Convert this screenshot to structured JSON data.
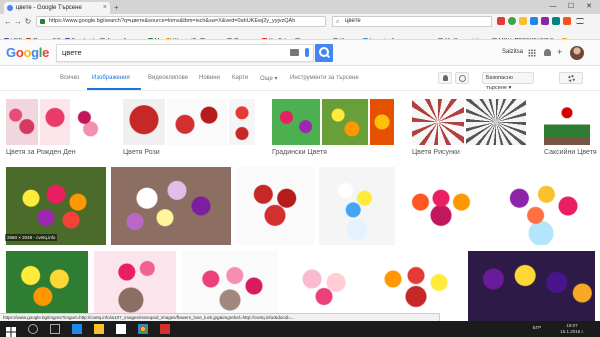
{
  "browser": {
    "tab_title": "цвете - Google Търсене",
    "close_tab_glyph": "×",
    "new_tab_glyph": "+",
    "url": "https://www.google.bg/search?q=цвете&source=lnms&tbm=isch&sa=X&ved=0ahUKEwj2y_yyjvzQAh",
    "find_text": "цвете",
    "controls": {
      "minimize": "—",
      "maximize": "☐",
      "close": "✕"
    }
  },
  "bookmarks": [
    {
      "label": "UBB",
      "color": "#3b5998"
    },
    {
      "label": "Проект ЕС",
      "color": "#c0392b"
    },
    {
      "label": "Facebook",
      "color": "#3b5998"
    },
    {
      "label": "Ангел Ангелов",
      "color": "#888888"
    },
    {
      "label": "My",
      "color": "#2e7d32"
    },
    {
      "label": "Школа IT",
      "color": "#f39c12"
    },
    {
      "label": "уча се",
      "color": "#888888"
    },
    {
      "label": "Падагози",
      "color": "#888888"
    },
    {
      "label": "YouTube",
      "color": "#e62117"
    },
    {
      "label": "за учители",
      "color": "#888888"
    },
    {
      "label": "Изпели",
      "color": "#888888"
    },
    {
      "label": "LearningApps.org - инте...",
      "color": "#2196f3"
    },
    {
      "label": "My Presentations",
      "color": "#888888"
    },
    {
      "label": "МОН: ПРОЕКТ ИКТ В...",
      "color": "#888888"
    },
    {
      "label": "уроци",
      "color": "#f39c12"
    }
  ],
  "google": {
    "logo": [
      "G",
      "o",
      "o",
      "g",
      "l",
      "e"
    ],
    "logo_colors": [
      "#4285f4",
      "#ea4335",
      "#fbbc05",
      "#4285f4",
      "#34a853",
      "#ea4335"
    ],
    "query": "цвете",
    "user_name": "Salzitsa"
  },
  "search_tabs": [
    {
      "label": "Всичко",
      "active": false
    },
    {
      "label": "Изображения",
      "active": true
    },
    {
      "label": "Видеоклипове",
      "active": false
    },
    {
      "label": "Новини",
      "active": false
    },
    {
      "label": "Карти",
      "active": false
    },
    {
      "label": "Още ▾",
      "active": false
    },
    {
      "label": "Инструменти за търсене",
      "active": false
    }
  ],
  "safe_search_label": "Безопасно търсене ▾",
  "related": [
    {
      "label": "Цветя за Рожден Ден"
    },
    {
      "label": "Цветя Рози"
    },
    {
      "label": "Градински Цветя"
    },
    {
      "label": "Цветя Рисунки"
    },
    {
      "label": "Саксийни Цветя"
    }
  ],
  "image_info": {
    "dimensions": "2560 × 2048 - cvetq.info",
    "source": "cvetq.info"
  },
  "status_url": "https://www.google.bg/imgres?imgurl=http://cvetq.info/w107_images/ressopod_images/flowers_love_luck.jpg&imgrefurl=http://cvetq.info/&docid=...",
  "taskbar": {
    "time": "19:07",
    "date": "15.1.2016 г.",
    "lang": "БГР"
  }
}
